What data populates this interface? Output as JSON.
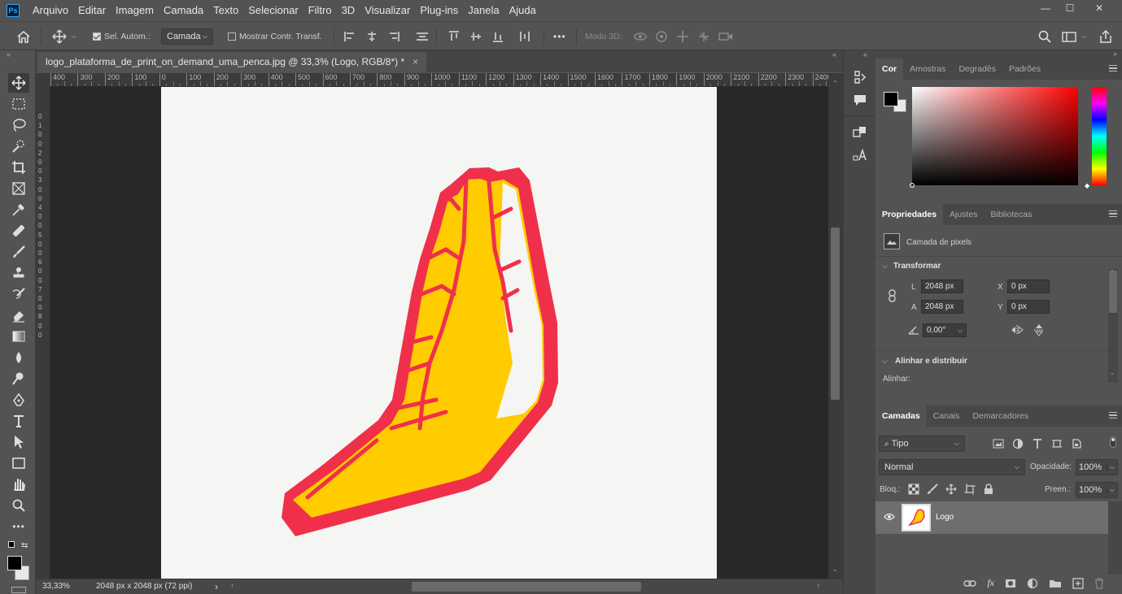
{
  "app": {
    "logo_text": "Ps"
  },
  "menubar": {
    "items": [
      "Arquivo",
      "Editar",
      "Imagem",
      "Camada",
      "Texto",
      "Selecionar",
      "Filtro",
      "3D",
      "Visualizar",
      "Plug-ins",
      "Janela",
      "Ajuda"
    ]
  },
  "window_controls": {
    "minimize": "—",
    "maximize": "☐",
    "close": "✕"
  },
  "options_bar": {
    "auto_select_label": "Sel. Autom.:",
    "auto_select_checked": true,
    "auto_select_target": "Camada",
    "show_transform_label": "Mostrar Contr. Transf.",
    "show_transform_checked": false,
    "mode_3d_label": "Modo 3D:",
    "more": "•••"
  },
  "document": {
    "tab_title": "logo_plataforma_de_print_on_demand_uma_penca.jpg @ 33,3% (Logo, RGB/8*) *",
    "close": "×"
  },
  "rulers": {
    "horizontal_ticks": [
      "400",
      "300",
      "200",
      "100",
      "0",
      "100",
      "200",
      "300",
      "400",
      "500",
      "600",
      "700",
      "800",
      "900",
      "1000",
      "1100",
      "1200",
      "1300",
      "1400",
      "1500",
      "1600",
      "1700",
      "1800",
      "1900",
      "2000",
      "2100",
      "2200",
      "2300",
      "2400"
    ],
    "vertical_ticks": [
      "0",
      "1",
      "0",
      "0",
      "2",
      "0",
      "0",
      "3",
      "0",
      "0",
      "4",
      "0",
      "0",
      "5",
      "0",
      "0",
      "6",
      "0",
      "0",
      "7",
      "0",
      "0",
      "8",
      "0",
      "0"
    ]
  },
  "status_bar": {
    "zoom": "33,33%",
    "doc_info": "2048 px x 2048 px (72 ppi)",
    "arrow": "›"
  },
  "color_panel": {
    "tabs": [
      "Cor",
      "Amostras",
      "Degradês",
      "Padrões"
    ],
    "active_tab": "Cor",
    "foreground": "#000000",
    "background": "#e8e8e8",
    "hue_color": "#ff0000"
  },
  "properties_panel": {
    "tabs": [
      "Propriedades",
      "Ajustes",
      "Bibliotecas"
    ],
    "active_tab": "Propriedades",
    "layer_type": "Camada de pixels",
    "transform_section": "Transformar",
    "w_label": "L",
    "w_value": "2048 px",
    "h_label": "A",
    "h_value": "2048 px",
    "x_label": "X",
    "x_value": "0 px",
    "y_label": "Y",
    "y_value": "0 px",
    "angle_value": "0,00°",
    "align_section": "Alinhar e distribuir",
    "align_label": "Alinhar:"
  },
  "layers_panel": {
    "tabs": [
      "Camadas",
      "Canais",
      "Demarcadores"
    ],
    "active_tab": "Camadas",
    "filter_kind": "Tipo",
    "blend_mode": "Normal",
    "opacity_label": "Opacidade:",
    "opacity_value": "100%",
    "lock_label": "Bloq.:",
    "fill_label": "Preen.:",
    "fill_value": "100%",
    "layers": [
      {
        "name": "Logo",
        "visible": true,
        "selected": true
      }
    ],
    "fx": "fx"
  },
  "artwork": {
    "hand_fill": "#ffcc00",
    "hand_outline": "#f0304a",
    "paper": "#f5f5f3"
  }
}
